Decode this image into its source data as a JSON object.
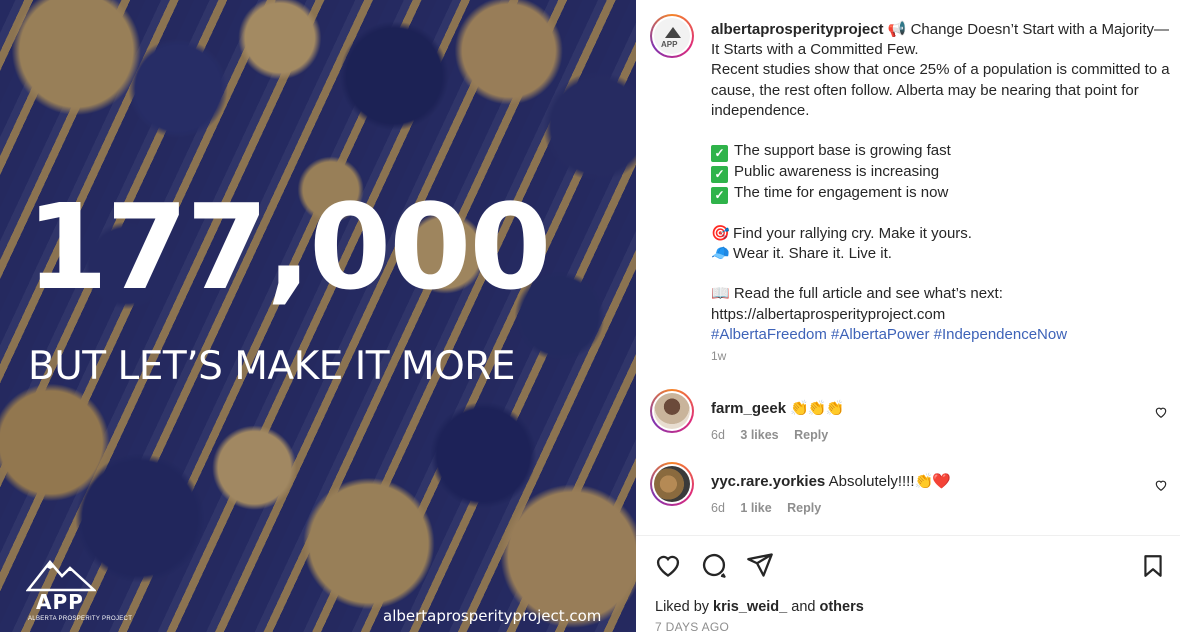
{
  "media": {
    "big_number": "177,000",
    "tagline": "BUT LET’S MAKE IT MORE",
    "logo_text": "APP",
    "logo_subtext": "ALBERTA PROSPERITY PROJECT",
    "url": "albertaprosperityproject.com",
    "colors": {
      "gold": "#c9a55c",
      "navy": "#2b3169"
    }
  },
  "post": {
    "username": "albertaprosperityproject",
    "headline_icon": "megaphone-icon",
    "headline": "📢 Change Doesn’t Start with a Majority—It Starts with a Committed Few.",
    "body": "Recent studies show that once 25% of a population is committed to a cause, the rest often follow. Alberta may be nearing that point for independence.",
    "checklist": [
      "The support base is growing fast",
      "Public awareness is increasing",
      "The time for engagement is now"
    ],
    "cta_lines": [
      {
        "icon": "🎯",
        "text": "Find your rallying cry. Make it yours."
      },
      {
        "icon": "🧢",
        "text": "Wear it. Share it. Live it."
      }
    ],
    "read_more": "📖 Read the full article and see what’s next:",
    "link": "https://albertaprosperityproject.com",
    "hashtags": "#AlbertaFreedom #AlbertaPower #IndependenceNow",
    "time_ago": "1w"
  },
  "comments": [
    {
      "username": "farm_geek",
      "text": "👏👏👏",
      "age": "6d",
      "likes": "3 likes",
      "reply": "Reply"
    },
    {
      "username": "yyc.rare.yorkies",
      "text": "Absolutely!!!!",
      "emoji": "👏❤️",
      "age": "6d",
      "likes": "1 like",
      "reply": "Reply"
    }
  ],
  "footer": {
    "liked_by_prefix": "Liked by",
    "liked_by_user": "kris_weid_",
    "liked_by_and": "and",
    "liked_by_others": "others",
    "date": "7 DAYS AGO"
  }
}
